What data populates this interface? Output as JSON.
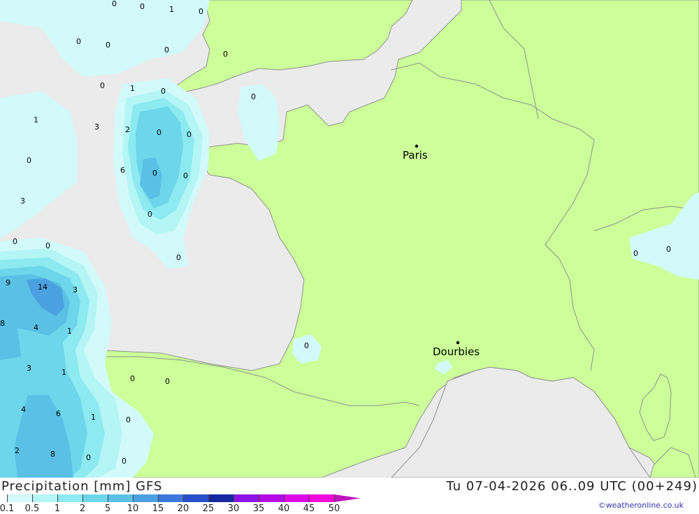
{
  "header": {
    "title": "Precipitation [mm] GFS",
    "valid_time": "Tu 07-04-2026 06..09 UTC (00+249)",
    "credit": "©weatheronline.co.uk"
  },
  "legend": {
    "labels": [
      "0.1",
      "0.5",
      "1",
      "2",
      "5",
      "10",
      "15",
      "20",
      "25",
      "30",
      "35",
      "40",
      "45",
      "50"
    ],
    "colors": [
      "#d2fafa",
      "#b4f5f5",
      "#8ceaf0",
      "#6ed6ea",
      "#5ac0e6",
      "#4ba0e1",
      "#3c78dc",
      "#2850c8",
      "#1428a0",
      "#8c14e6",
      "#b40ae6",
      "#dc0ae6",
      "#f00adc",
      "#be14be"
    ]
  },
  "map": {
    "colors": {
      "sea": "#ebebeb",
      "land": "#ccff99",
      "border": "#909090"
    },
    "cities": [
      {
        "name": "Paris"
      },
      {
        "name": "Dourbies"
      }
    ],
    "values": [
      "0",
      "0",
      "1",
      "0",
      "0",
      "0",
      "0",
      "0",
      "0",
      "1",
      "0",
      "0",
      "1",
      "3",
      "2",
      "0",
      "0",
      "0",
      "6",
      "0",
      "0",
      "3",
      "0",
      "0",
      "0",
      "0",
      "9",
      "14",
      "3",
      "8",
      "4",
      "1",
      "3",
      "1",
      "0",
      "0",
      "4",
      "6",
      "1",
      "0",
      "2",
      "8",
      "0",
      "0",
      "0",
      "0",
      "0"
    ]
  }
}
